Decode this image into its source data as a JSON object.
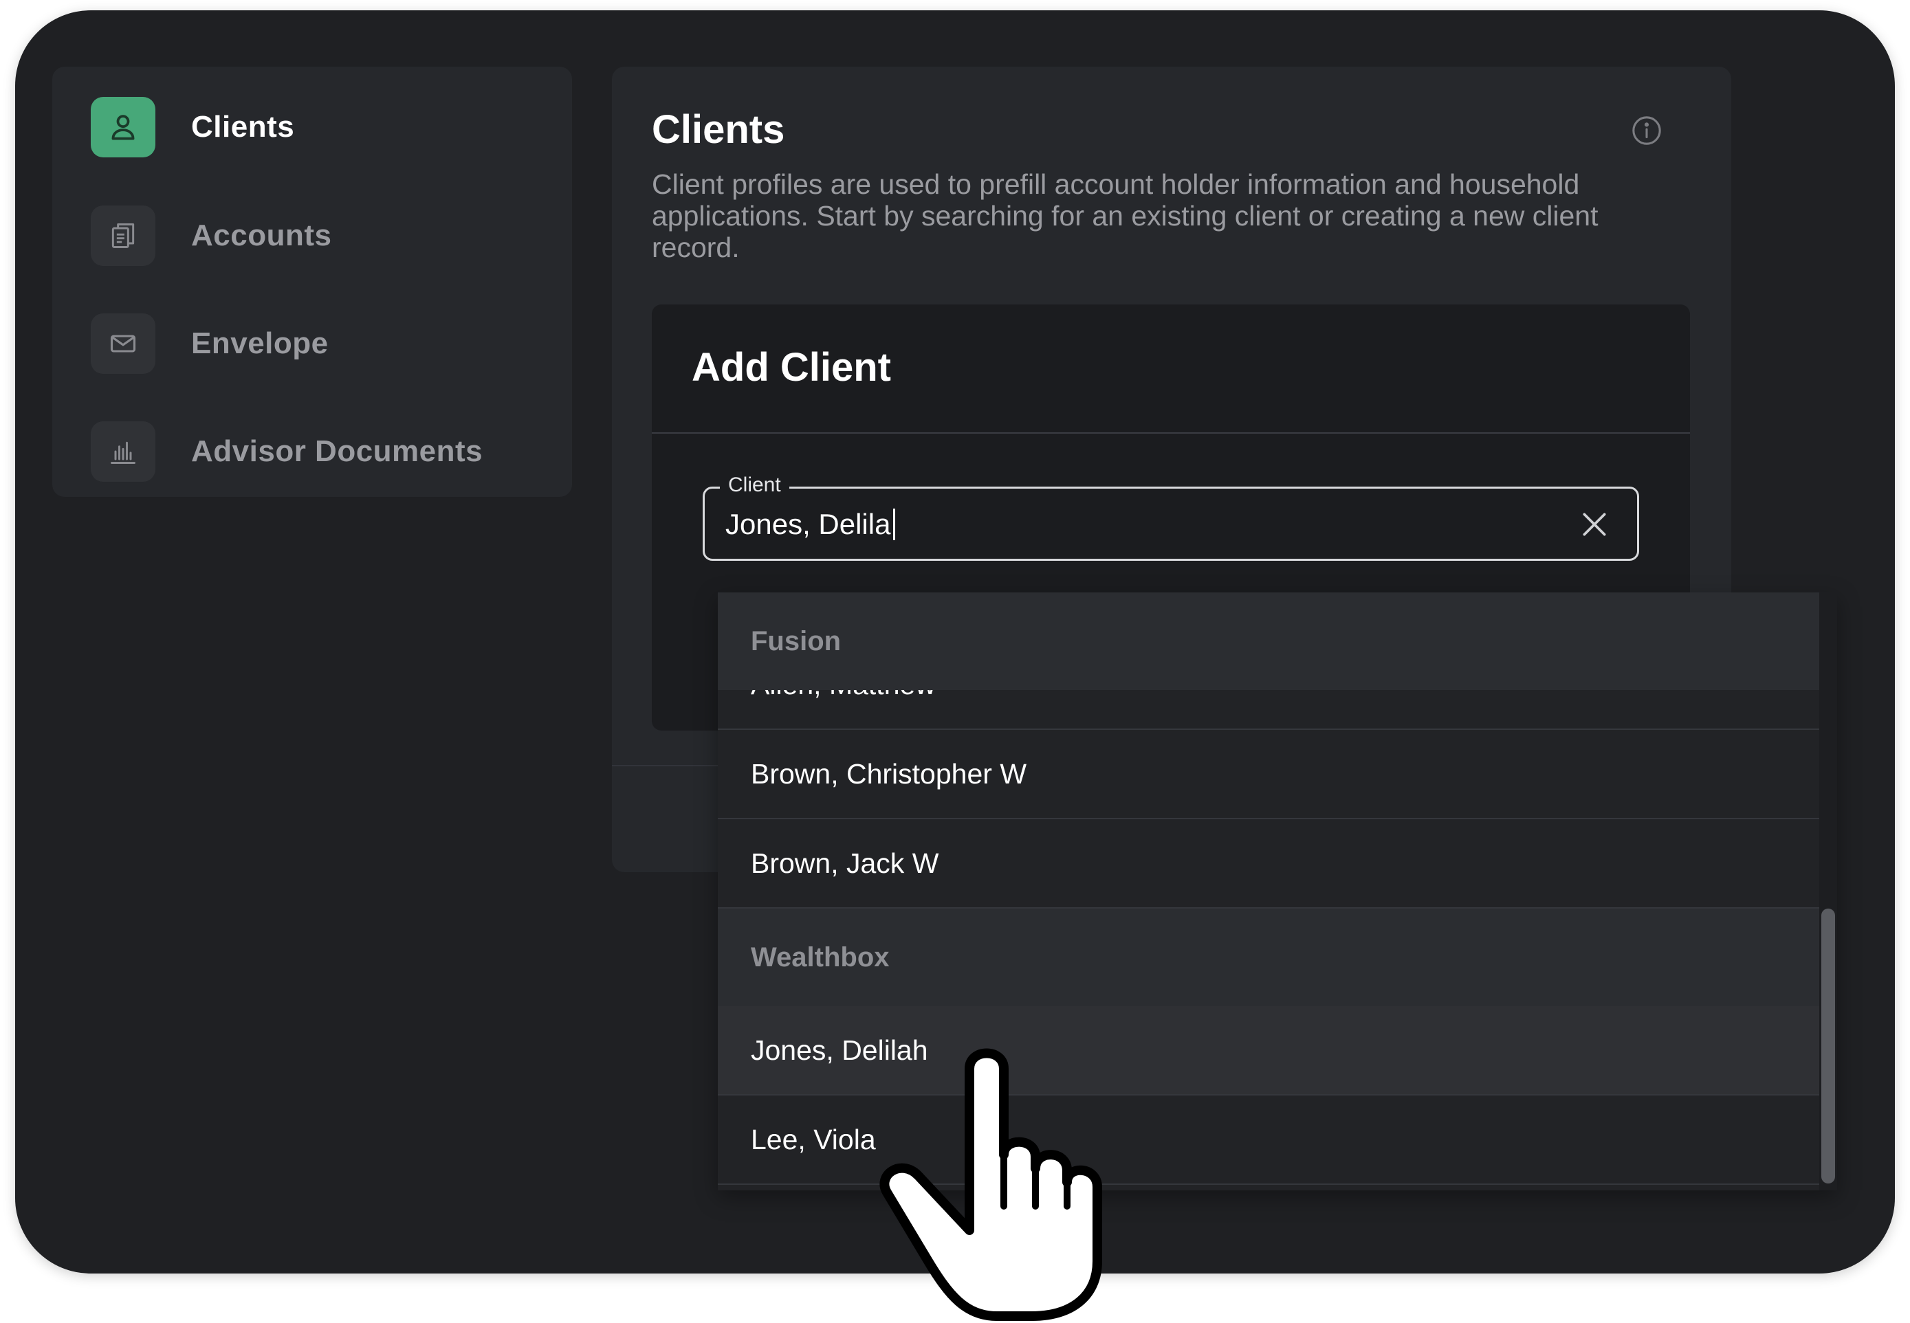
{
  "sidebar": {
    "items": [
      {
        "label": "Clients",
        "icon": "person-icon",
        "active": true
      },
      {
        "label": "Accounts",
        "icon": "documents-icon",
        "active": false
      },
      {
        "label": "Envelope",
        "icon": "envelope-icon",
        "active": false
      },
      {
        "label": "Advisor Documents",
        "icon": "bar-chart-icon",
        "active": false
      }
    ]
  },
  "main": {
    "title": "Clients",
    "description": "Client profiles are used to prefill account holder information and household applications. Start by searching for an existing client or creating a new client record.",
    "info_icon": "info-icon"
  },
  "card": {
    "title": "Add Client",
    "field_label": "Client",
    "field_value": "Jones, Delila",
    "clear_icon": "close-icon"
  },
  "dropdown": {
    "groups": [
      {
        "name": "Fusion",
        "items": [
          "Allen, Matthew",
          "Brown, Christopher W",
          "Brown, Jack W"
        ]
      },
      {
        "name": "Wealthbox",
        "items": [
          "Jones, Delilah",
          "Lee, Viola"
        ]
      }
    ],
    "highlighted": "Jones, Delilah"
  },
  "colors": {
    "accent": "#47a879",
    "background": "#1f2023",
    "panel": "#26282c"
  }
}
